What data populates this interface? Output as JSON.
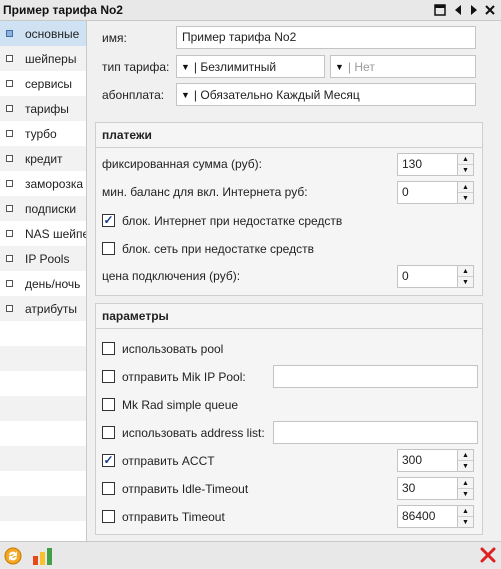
{
  "window": {
    "title": "Пример тарифа No2"
  },
  "sidebar": {
    "items": [
      {
        "label": "основные",
        "active": true
      },
      {
        "label": "шейперы"
      },
      {
        "label": "сервисы"
      },
      {
        "label": "тарифы"
      },
      {
        "label": "турбо"
      },
      {
        "label": "кредит"
      },
      {
        "label": "заморозка"
      },
      {
        "label": "подписки"
      },
      {
        "label": "NAS шейперы"
      },
      {
        "label": "IP Pools"
      },
      {
        "label": "день/ночь"
      },
      {
        "label": "атрибуты"
      }
    ]
  },
  "general": {
    "name_label": "имя:",
    "name_value": "Пример тарифа No2",
    "tariff_type_label": "тип тарифа:",
    "tariff_type_value": "| Безлимитный",
    "tariff_type_secondary": "| Нет",
    "fee_label": "абонплата:",
    "fee_value": "| Обязательно Каждый Месяц"
  },
  "payments": {
    "title": "платежи",
    "fixed_sum_label": "фиксированная сумма (руб):",
    "fixed_sum_value": "130",
    "min_balance_label": "мин. баланс для вкл. Интернета руб:",
    "min_balance_value": "0",
    "block_internet_label": "блок. Интернет при недостатке средств",
    "block_internet_checked": true,
    "block_network_label": "блок. сеть при недостатке средств",
    "block_network_checked": false,
    "connection_price_label": "цена подключения (руб):",
    "connection_price_value": "0"
  },
  "params": {
    "title": "параметры",
    "use_pool_label": "использовать pool",
    "send_mik_label": "отправить Mik IP Pool:",
    "mk_rad_label": "Mk Rad simple queue",
    "address_list_label": "использовать address list:",
    "send_acct_label": "отправить ACCT",
    "send_acct_value": "300",
    "send_idle_label": "отправить Idle-Timeout",
    "send_idle_value": "30",
    "send_timeout_label": "отправить Timeout",
    "send_timeout_value": "86400"
  },
  "colors": {
    "accent": "#cfe2f3",
    "check": "#1a3c8a",
    "close": "#e02020"
  }
}
